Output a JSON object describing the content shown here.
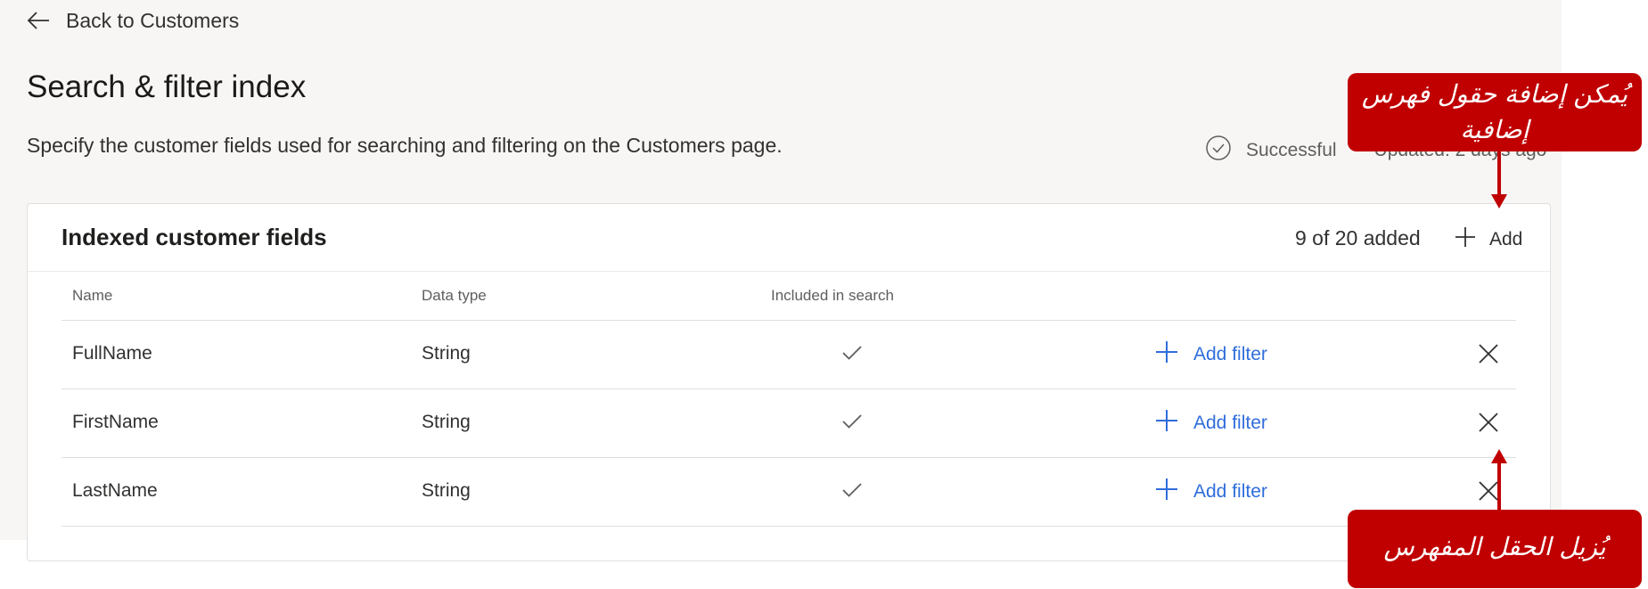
{
  "nav": {
    "back_label": "Back to Customers"
  },
  "header": {
    "title": "Search & filter index",
    "description": "Specify the customer fields used for searching and filtering on the Customers page.",
    "status": "Successful",
    "updated": "Updated: 2 days ago"
  },
  "card": {
    "title": "Indexed customer fields",
    "count": "9 of 20 added",
    "add_label": "Add"
  },
  "table": {
    "columns": [
      "Name",
      "Data type",
      "Included in search"
    ],
    "rows": [
      {
        "name": "FullName",
        "type": "String",
        "included": true,
        "filter_label": "Add filter"
      },
      {
        "name": "FirstName",
        "type": "String",
        "included": true,
        "filter_label": "Add filter"
      },
      {
        "name": "LastName",
        "type": "String",
        "included": true,
        "filter_label": "Add filter"
      }
    ]
  },
  "annotations": {
    "add_callout": "يُمكن إضافة حقول فهرس إضافية",
    "remove_callout": "يُزيل الحقل المفهرس"
  },
  "colors": {
    "accent": "#2f6ddb",
    "callout": "#c00000",
    "background": "#f7f6f5"
  },
  "icons": [
    "arrow-left-icon",
    "checkmark-circle-icon",
    "plus-icon",
    "checkmark-icon",
    "close-icon"
  ]
}
